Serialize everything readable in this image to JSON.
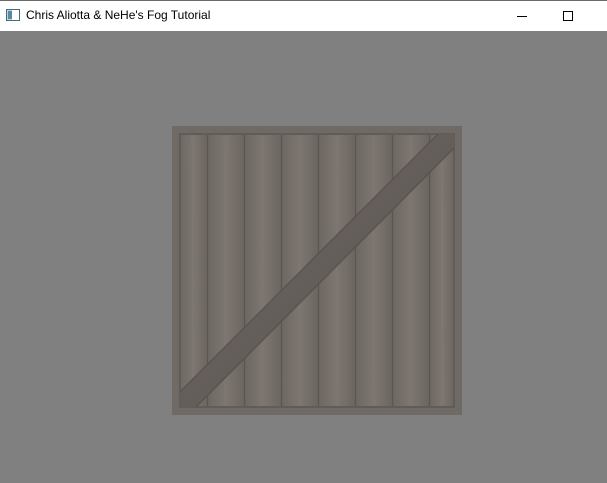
{
  "window": {
    "title": "Chris Aliotta & NeHe's Fog Tutorial",
    "app_icon": "window-app-icon",
    "controls": {
      "minimize_icon": "minimize-icon",
      "maximize_icon": "maximize-icon"
    }
  },
  "scene": {
    "background_color": "#808080",
    "object": "wooden-crate",
    "crate_colors": {
      "frame": "#6f6a66",
      "planks": "#7a736d",
      "brace": "#6a635e"
    }
  }
}
